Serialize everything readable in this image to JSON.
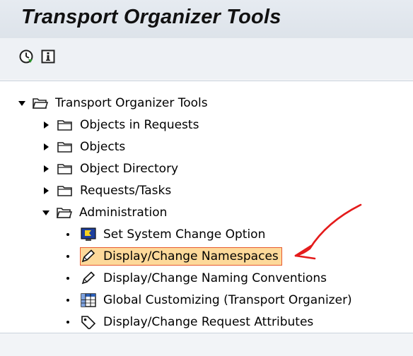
{
  "window": {
    "title": "Transport Organizer Tools"
  },
  "toolbar": {
    "buttons": [
      {
        "icon": "execute-clock-icon"
      },
      {
        "icon": "info-icon"
      }
    ]
  },
  "tree": {
    "root": {
      "label": "Transport Organizer Tools",
      "expanded": true
    },
    "folders": [
      {
        "label": "Objects in Requests",
        "expanded": false
      },
      {
        "label": "Objects",
        "expanded": false
      },
      {
        "label": "Object Directory",
        "expanded": false
      },
      {
        "label": "Requests/Tasks",
        "expanded": false
      },
      {
        "label": "Administration",
        "expanded": true
      }
    ],
    "admin_items": [
      {
        "label": "Set System Change Option",
        "icon": "monitor-flag-icon"
      },
      {
        "label": "Display/Change Namespaces",
        "icon": "pencil-icon",
        "selected": true
      },
      {
        "label": "Display/Change Naming Conventions",
        "icon": "pencil-icon"
      },
      {
        "label": "Global Customizing (Transport Organizer)",
        "icon": "table-icon"
      },
      {
        "label": "Display/Change Request Attributes",
        "icon": "tag-icon"
      }
    ]
  },
  "annotation": {
    "color": "#e41b1b"
  }
}
